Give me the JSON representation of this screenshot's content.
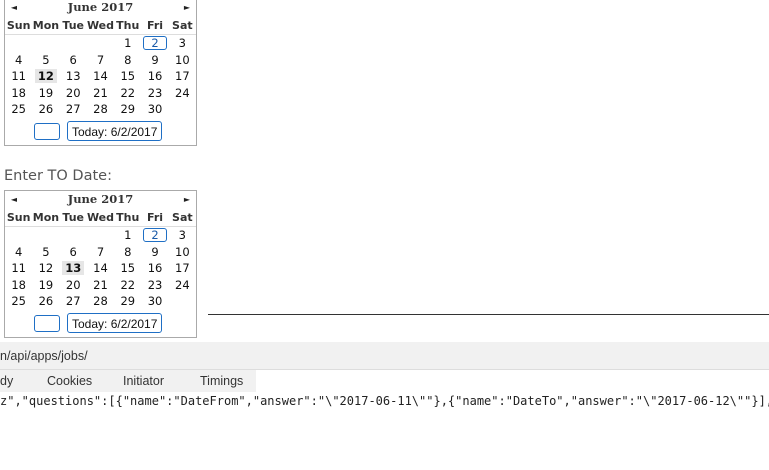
{
  "from_calendar": {
    "month_label": "June 2017",
    "prev_glyph": "◄",
    "next_glyph": "►",
    "weekdays": [
      "Sun",
      "Mon",
      "Tue",
      "Wed",
      "Thu",
      "Fri",
      "Sat"
    ],
    "weeks": [
      [
        "",
        "",
        "",
        "",
        "1",
        "2",
        "3"
      ],
      [
        "4",
        "5",
        "6",
        "7",
        "8",
        "9",
        "10"
      ],
      [
        "11",
        "12",
        "13",
        "14",
        "15",
        "16",
        "17"
      ],
      [
        "18",
        "19",
        "20",
        "21",
        "22",
        "23",
        "24"
      ],
      [
        "25",
        "26",
        "27",
        "28",
        "29",
        "30",
        ""
      ]
    ],
    "today_day": "2",
    "selected_day": "12",
    "today_button": "Today: 6/2/2017"
  },
  "to_label": "Enter TO Date:",
  "to_calendar": {
    "month_label": "June 2017",
    "prev_glyph": "◄",
    "next_glyph": "►",
    "weekdays": [
      "Sun",
      "Mon",
      "Tue",
      "Wed",
      "Thu",
      "Fri",
      "Sat"
    ],
    "weeks": [
      [
        "",
        "",
        "",
        "",
        "1",
        "2",
        "3"
      ],
      [
        "4",
        "5",
        "6",
        "7",
        "8",
        "9",
        "10"
      ],
      [
        "11",
        "12",
        "13",
        "14",
        "15",
        "16",
        "17"
      ],
      [
        "18",
        "19",
        "20",
        "21",
        "22",
        "23",
        "24"
      ],
      [
        "25",
        "26",
        "27",
        "28",
        "29",
        "30",
        ""
      ]
    ],
    "today_day": "2",
    "selected_day": "13",
    "today_button": "Today: 6/2/2017"
  },
  "devtools": {
    "url_text": "n/api/apps/jobs/",
    "tabs": [
      "dy",
      "Cookies",
      "Initiator",
      "Timings"
    ],
    "payload": "z\",\"questions\":[{\"name\":\"DateFrom\",\"answer\":\"\\\"2017-06-11\\\"\"},{\"name\":\"DateTo\",\"answer\":\"\\\"2017-06-12\\\"\"}],\"jo"
  },
  "colors": {
    "accent_border": "#1f6fc5",
    "selected_bg": "#e6e6e6",
    "devtools_bar": "#f1f1f1"
  }
}
